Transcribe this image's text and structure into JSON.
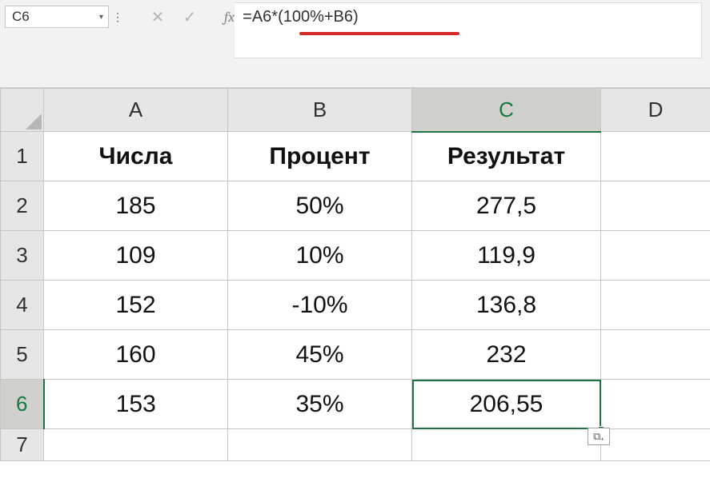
{
  "name_box": {
    "value": "C6"
  },
  "formula_bar": {
    "formula": "=A6*(100%+B6)"
  },
  "columns": [
    "A",
    "B",
    "C",
    "D"
  ],
  "active_column_index": 2,
  "rows": [
    "1",
    "2",
    "3",
    "4",
    "5",
    "6",
    "7"
  ],
  "active_row_index": 5,
  "headers": {
    "A": "Числа",
    "B": "Процент",
    "C": "Результат"
  },
  "data": [
    {
      "A": "185",
      "B": "50%",
      "C": "277,5"
    },
    {
      "A": "109",
      "B": "10%",
      "C": "119,9"
    },
    {
      "A": "152",
      "B": "-10%",
      "C": "136,8"
    },
    {
      "A": "160",
      "B": "45%",
      "C": "232"
    },
    {
      "A": "153",
      "B": "35%",
      "C": "206,55"
    }
  ],
  "icons": {
    "dropdown": "▾",
    "dots": "⋮",
    "cancel": "✕",
    "enter": "✓",
    "fx": "fx",
    "autofill": "⧉₊"
  }
}
